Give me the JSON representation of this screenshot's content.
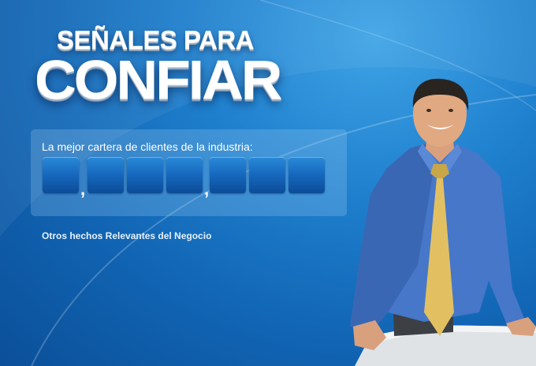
{
  "banner": {
    "title_line1": "SEÑALES PARA",
    "title_line2": "CONFIAR"
  },
  "counter": {
    "label": "La mejor cartera de clientes de la industria:",
    "digits": [
      "",
      "",
      "",
      "",
      "",
      "",
      ""
    ],
    "separator": ","
  },
  "links": {
    "other_facts": "Otros hechos Relevantes del Negocio"
  },
  "colors": {
    "background": "#1e7fcd",
    "digit_box": "#1667bd",
    "tie": "#e2c062",
    "shirt": "#4677c8"
  }
}
